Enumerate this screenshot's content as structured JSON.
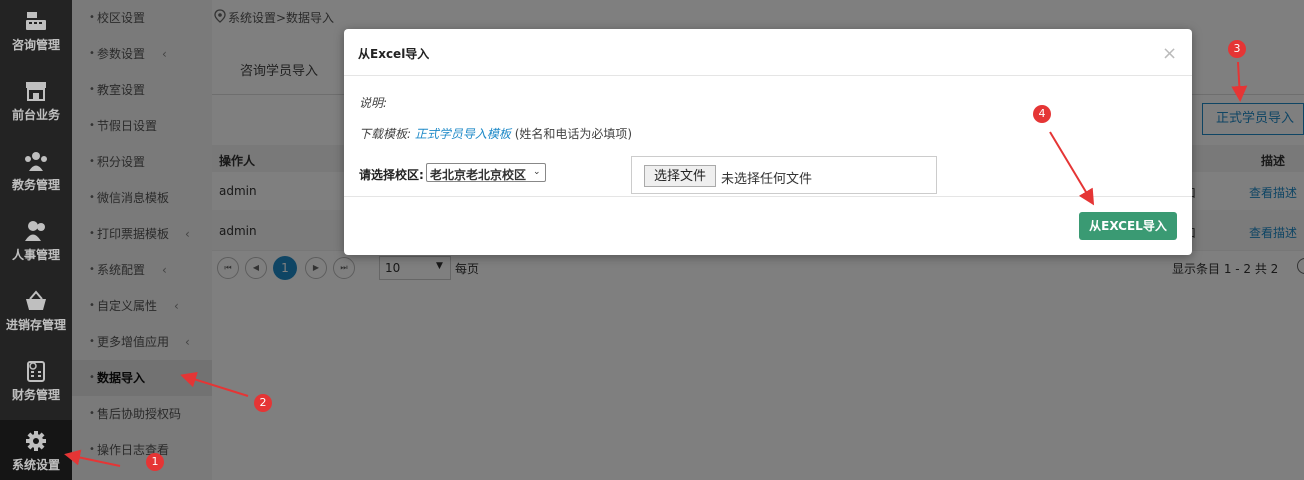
{
  "nav": [
    {
      "label": "咨询管理",
      "icon": "cash-register-icon"
    },
    {
      "label": "前台业务",
      "icon": "storefront-icon"
    },
    {
      "label": "教务管理",
      "icon": "users-group-icon"
    },
    {
      "label": "人事管理",
      "icon": "user-pair-icon"
    },
    {
      "label": "进销存管理",
      "icon": "basket-icon"
    },
    {
      "label": "财务管理",
      "icon": "calculator-icon"
    },
    {
      "label": "系统设置",
      "icon": "gear-icon"
    }
  ],
  "submenu": [
    {
      "label": "校区设置",
      "chevron": ""
    },
    {
      "label": "参数设置",
      "chevron": "‹"
    },
    {
      "label": "教室设置",
      "chevron": ""
    },
    {
      "label": "节假日设置",
      "chevron": ""
    },
    {
      "label": "积分设置",
      "chevron": ""
    },
    {
      "label": "微信消息模板",
      "chevron": ""
    },
    {
      "label": "打印票据模板",
      "chevron": "‹"
    },
    {
      "label": "系统配置",
      "chevron": "‹"
    },
    {
      "label": "自定义属性",
      "chevron": "‹"
    },
    {
      "label": "更多增值应用",
      "chevron": "‹"
    },
    {
      "label": "数据导入",
      "chevron": ""
    },
    {
      "label": "售后协助授权码",
      "chevron": ""
    },
    {
      "label": "操作日志查看",
      "chevron": ""
    }
  ],
  "breadcrumb": "系统设置>数据导入",
  "tabs": {
    "consult": "咨询学员导入"
  },
  "import_student_button": "正式学员导入",
  "table": {
    "headers": {
      "operator": "操作人",
      "description": "描述"
    },
    "rows": [
      {
        "operator": "admin",
        "partial": "口",
        "link": "查看描述"
      },
      {
        "operator": "admin",
        "partial": "口",
        "link": "查看描述"
      }
    ]
  },
  "pagination": {
    "current": "1",
    "page_size": "10",
    "per_page_label": "每页",
    "summary": "显示条目 1 - 2 共 2"
  },
  "dialog": {
    "title": "从Excel导入",
    "close": "×",
    "note": "说明:",
    "template_prefix": "下载模板:",
    "template_link": "正式学员导入模板",
    "template_suffix": "(姓名和电话为必填项)",
    "campus_label": "请选择校区:",
    "campus_value": "老北京老北京校区",
    "file_button": "选择文件",
    "file_status": "未选择任何文件",
    "submit": "从EXCEL导入"
  },
  "markers": [
    "1",
    "2",
    "3",
    "4"
  ],
  "colors": {
    "accent_blue": "#1f8ac8",
    "submit_green": "#3a9a73",
    "marker_red": "#e53535",
    "nav_bg": "#2f2f2f"
  }
}
